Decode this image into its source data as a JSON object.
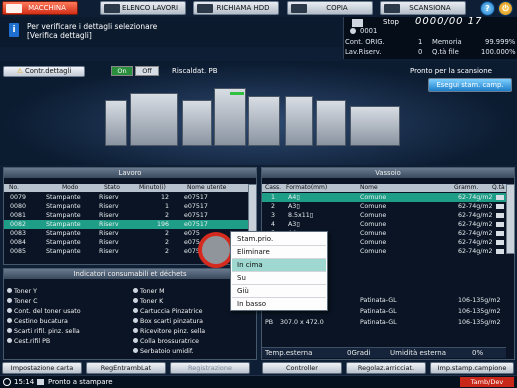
{
  "tabs": [
    {
      "label": "MACCHINA",
      "icon": "printer-icon",
      "active": true
    },
    {
      "label": "ELENCO LAVORI",
      "icon": "job-list-icon",
      "active": false
    },
    {
      "label": "RICHIAMA HDD",
      "icon": "hdd-icon",
      "active": false
    },
    {
      "label": "COPIA",
      "icon": "copy-icon",
      "active": false
    },
    {
      "label": "SCANSIONA",
      "icon": "scan-icon",
      "active": false
    }
  ],
  "message": {
    "line1": "Per verificare i dettagli selezionare",
    "line2": "[Verifica dettagli]"
  },
  "status_panel": {
    "state": "Stop",
    "counter": "0000/00 17",
    "user": "0001",
    "cont_orig_label": "Cont. ORIG.",
    "cont_orig_value": "1",
    "memoria_label": "Memoria",
    "memoria_value": "99.999%",
    "lav_riserv_label": "Lav.Riserv.",
    "lav_riserv_value": "0",
    "qta_file_label": "Q.tà file",
    "qta_file_value": "100.000%"
  },
  "controls": {
    "contr_dettagli": "Contr.dettagli",
    "on": "On",
    "off": "Off",
    "riscaldat": "Riscaldat. PB",
    "pronto_scansione": "Pronto per la scansione",
    "esegui": "Esegui stam. camp."
  },
  "lavoro": {
    "title": "Lavoro",
    "columns": [
      "No.",
      "Modo",
      "Stato",
      "Minuto(i)",
      "Nome utente"
    ],
    "rows": [
      {
        "no": "0079",
        "modo": "Stampante",
        "stato": "Riserv",
        "min": "12",
        "user": "e07517",
        "selected": false
      },
      {
        "no": "0080",
        "modo": "Stampante",
        "stato": "Riserv",
        "min": "1",
        "user": "e07517",
        "selected": false
      },
      {
        "no": "0081",
        "modo": "Stampante",
        "stato": "Riserv",
        "min": "2",
        "user": "e07517",
        "selected": false
      },
      {
        "no": "0082",
        "modo": "Stampante",
        "stato": "Riserv",
        "min": "196",
        "user": "e07517",
        "selected": true
      },
      {
        "no": "0083",
        "modo": "Stampante",
        "stato": "Riserv",
        "min": "2",
        "user": "e075",
        "selected": false
      },
      {
        "no": "0084",
        "modo": "Stampante",
        "stato": "Riserv",
        "min": "2",
        "user": "e075",
        "selected": false
      },
      {
        "no": "0085",
        "modo": "Stampante",
        "stato": "Riserv",
        "min": "2",
        "user": "e075",
        "selected": false
      }
    ]
  },
  "context_menu": {
    "items": [
      {
        "label": "Stam.prio.",
        "highlight": false
      },
      {
        "label": "Eliminare",
        "highlight": false
      },
      {
        "label": "In cima",
        "highlight": true
      },
      {
        "label": "Su",
        "highlight": false
      },
      {
        "label": "Giù",
        "highlight": false
      },
      {
        "label": "In basso",
        "highlight": false
      }
    ]
  },
  "vassoio": {
    "title": "Vassoio",
    "columns": [
      "Cass.",
      "Formato(mm)",
      "Nome",
      "Gramm.",
      "Q.tà"
    ],
    "rows": [
      {
        "cass": "1",
        "formato": "A4▯",
        "nome": "Comune",
        "gramm": "62-74g/m2",
        "selected": true
      },
      {
        "cass": "2",
        "formato": "A3▯",
        "nome": "Comune",
        "gramm": "62-74g/m2",
        "selected": false
      },
      {
        "cass": "3",
        "formato": "8.5x11▯",
        "nome": "Comune",
        "gramm": "62-74g/m2",
        "selected": false
      },
      {
        "cass": "4",
        "formato": "A3▯",
        "nome": "Comune",
        "gramm": "62-74g/m2",
        "selected": false
      },
      {
        "cass": "5",
        "formato": "A4▯",
        "nome": "Comune",
        "gramm": "62-74g/m2",
        "selected": false
      },
      {
        "cass": "",
        "formato": "",
        "nome": "Comune",
        "gramm": "62-74g/m2",
        "selected": false
      },
      {
        "cass": "",
        "formato": "",
        "nome": "Comune",
        "gramm": "62-74g/m2",
        "selected": false
      }
    ],
    "rows2": [
      {
        "cass": "",
        "formato": "",
        "nome": "Patinata-GL",
        "gramm": "106-135g/m2"
      },
      {
        "cass": "",
        "formato": "",
        "nome": "Patinata-GL",
        "gramm": "106-135g/m2"
      },
      {
        "cass": "PB",
        "formato": "307.0 x 472.0",
        "nome": "Patinata-GL",
        "gramm": "106-135g/m2"
      }
    ],
    "temp_label": "Temp.esterna",
    "temp_value": "0Gradi",
    "umidita_label": "Umidità esterna",
    "umidita_value": "0%"
  },
  "consumabili": {
    "title": "Indicatori consumabili et déchets",
    "left": [
      "Toner Y",
      "Toner C",
      "Cont. del toner usato",
      "Cestino bucatura",
      "Scarti rifil. pinz. sella",
      "Cest.rifil PB"
    ],
    "right": [
      "Toner M",
      "Toner K",
      "Cartuccia Pinzatrice",
      "Box scarti pinzatura",
      "Ricevitore pinz. sella",
      "Colla brossuratrice",
      "Serbatoio umidif."
    ]
  },
  "bottom_buttons": [
    "Impostazione carta",
    "RegEntrambLat",
    "Registrazione",
    "Controller",
    "Regolaz.arricciat.",
    "Imp.stamp.campione"
  ],
  "statusbar": {
    "time": "15:14",
    "status": "Pronto a stampare",
    "right": "Tamb/Dev"
  },
  "colors": {
    "active_tab": "#d22f17",
    "selected_row": "#1e9e87",
    "highlight_menu": "#9fd8d0"
  }
}
